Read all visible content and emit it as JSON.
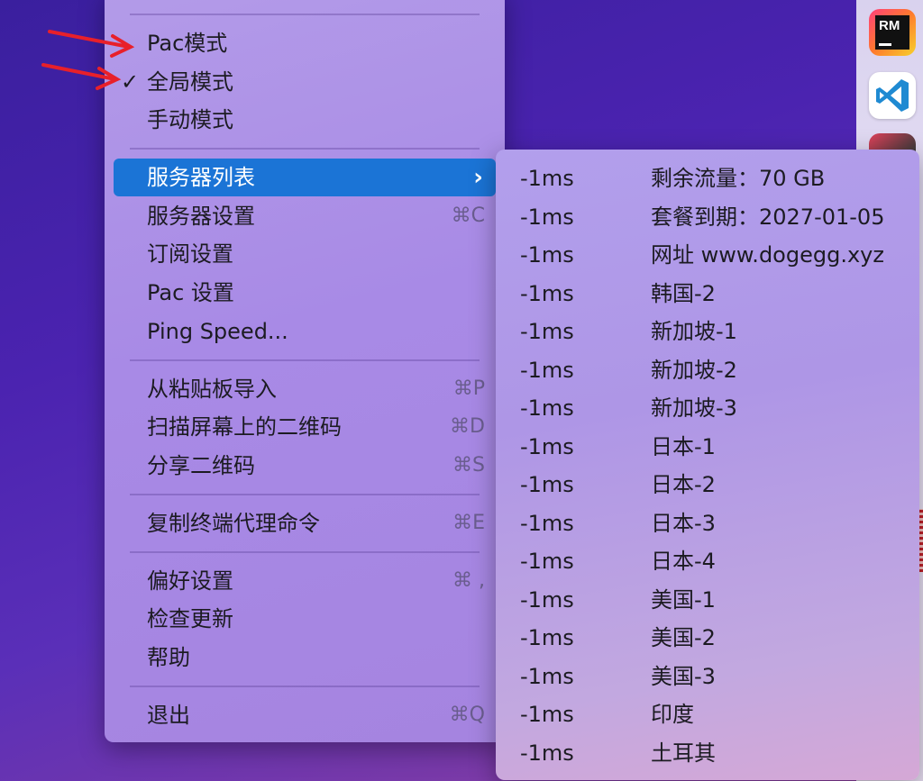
{
  "dock": {
    "apps": [
      {
        "name": "rm-app",
        "label": "RM"
      },
      {
        "name": "vscode",
        "label": ""
      }
    ]
  },
  "menu": {
    "items": [
      {
        "label": "Pac模式",
        "checked": false,
        "shortcut": ""
      },
      {
        "label": "全局模式",
        "checked": true,
        "shortcut": ""
      },
      {
        "label": "手动模式",
        "checked": false,
        "shortcut": ""
      },
      {
        "label": "服务器列表",
        "highlighted": true,
        "shortcut": "",
        "submenu": true
      },
      {
        "label": "服务器设置",
        "shortcut": "⌘C"
      },
      {
        "label": "订阅设置",
        "shortcut": ""
      },
      {
        "label": "Pac 设置",
        "shortcut": ""
      },
      {
        "label": "Ping Speed...",
        "shortcut": ""
      },
      {
        "label": "从粘贴板导入",
        "shortcut": "⌘P"
      },
      {
        "label": "扫描屏幕上的二维码",
        "shortcut": "⌘D"
      },
      {
        "label": "分享二维码",
        "shortcut": "⌘S"
      },
      {
        "label": "复制终端代理命令",
        "shortcut": "⌘E"
      },
      {
        "label": "偏好设置",
        "shortcut": "⌘ ,"
      },
      {
        "label": "检查更新",
        "shortcut": ""
      },
      {
        "label": "帮助",
        "shortcut": ""
      },
      {
        "label": "退出",
        "shortcut": "⌘Q"
      }
    ],
    "check_glyph": "✓",
    "chevron_glyph": "›"
  },
  "servers": [
    {
      "ping": "-1ms",
      "name": "剩余流量：70 GB"
    },
    {
      "ping": "-1ms",
      "name": "套餐到期：2027-01-05"
    },
    {
      "ping": "-1ms",
      "name": "网址 www.dogegg.xyz"
    },
    {
      "ping": "-1ms",
      "name": "韩国-2"
    },
    {
      "ping": "-1ms",
      "name": "新加坡-1"
    },
    {
      "ping": "-1ms",
      "name": "新加坡-2"
    },
    {
      "ping": "-1ms",
      "name": "新加坡-3"
    },
    {
      "ping": "-1ms",
      "name": "日本-1"
    },
    {
      "ping": "-1ms",
      "name": "日本-2"
    },
    {
      "ping": "-1ms",
      "name": "日本-3"
    },
    {
      "ping": "-1ms",
      "name": "日本-4"
    },
    {
      "ping": "-1ms",
      "name": "美国-1"
    },
    {
      "ping": "-1ms",
      "name": "美国-2"
    },
    {
      "ping": "-1ms",
      "name": "美国-3"
    },
    {
      "ping": "-1ms",
      "name": "印度"
    },
    {
      "ping": "-1ms",
      "name": "土耳其"
    }
  ],
  "colors": {
    "highlight": "#1b74d6",
    "annotation_arrow": "#e8202a"
  }
}
